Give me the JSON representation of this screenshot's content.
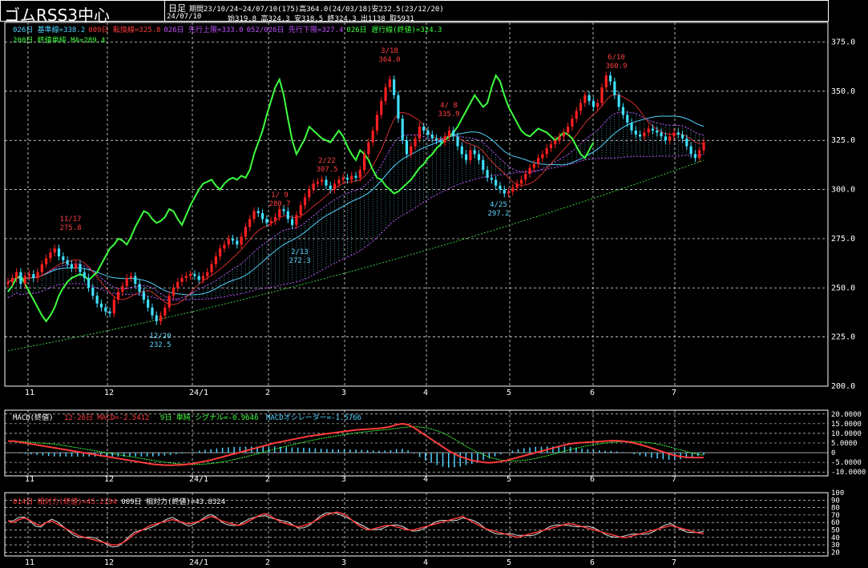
{
  "header": {
    "title": "ゴムRSS3中心",
    "period_type": "日足",
    "period_info": "期間23/10/24~24/07/10(175)高364.0(24/03/18)安232.5(23/12/20)",
    "date": "24/07/10",
    "ohlc": "始319.8 高324.3 安318.5 終324.3 出1138 取5931"
  },
  "legend_main": {
    "line1": [
      {
        "text": "026日 基準線=338.2",
        "color": "#4fd3ff"
      },
      {
        "text": "009日 転換線=325.8",
        "color": "#ff3b3b"
      },
      {
        "text": "026日 先行上限=333.0",
        "color": "#c050ff"
      },
      {
        "text": "052/026日 先行下限=327.4",
        "color": "#c050ff"
      },
      {
        "text": "026日 遅行線(終値)=324.3",
        "color": "#3fff3f"
      }
    ],
    "line2": {
      "text": "200日 終値単純 MA=289.4",
      "color": "#3fff3f"
    }
  },
  "legend_macd": {
    "label": "MACD(終値)",
    "macd": "12-26日 MACD=-2.5412",
    "signal": "9日 単純 シグナル=-0.9646",
    "osc": "MACDオシレーター=-1.5766"
  },
  "legend_rsi": {
    "rsi14": "014日 相対力(終値)=45.2194",
    "rsi9": "009日 相対力(終値)=43.8324"
  },
  "colors": {
    "up": "#ff2020",
    "down": "#40e0ff",
    "kijun": "#4fd3ff",
    "tenkan": "#ff3b3b",
    "chikou": "#3fff3f",
    "ma": "#3fcf3f",
    "cloud": "#c050ff",
    "grid": "#ffffff"
  },
  "chart_data": [
    {
      "type": "candlestick",
      "name": "price",
      "x_labels": [
        "11",
        "12",
        "24/1",
        "2",
        "3",
        "4",
        "5",
        "6",
        "7"
      ],
      "y_ticks": [
        200.0,
        225.0,
        250.0,
        275.0,
        300.0,
        325.0,
        350.0,
        375.0
      ],
      "ylim": [
        200,
        385
      ],
      "grid": true,
      "close": [
        253,
        255,
        258,
        252,
        256,
        257,
        255,
        258,
        262,
        265,
        268,
        270,
        266,
        264,
        262,
        260,
        262,
        258,
        255,
        250,
        246,
        242,
        240,
        238,
        237,
        244,
        248,
        251,
        255,
        256,
        252,
        248,
        244,
        240,
        236,
        233,
        236,
        240,
        246,
        250,
        253,
        255,
        256,
        257,
        256,
        254,
        256,
        258,
        262,
        266,
        270,
        272,
        275,
        274,
        272,
        276,
        281,
        285,
        289,
        288,
        285,
        283,
        284,
        286,
        290,
        289,
        285,
        282,
        287,
        292,
        296,
        300,
        303,
        304,
        305,
        302,
        300,
        303,
        305,
        306,
        305,
        307,
        306,
        310,
        318,
        324,
        330,
        338,
        345,
        352,
        356,
        348,
        336,
        325,
        318,
        322,
        326,
        332,
        330,
        328,
        326,
        325,
        324,
        327,
        330,
        327,
        322,
        318,
        315,
        320,
        318,
        315,
        310,
        306,
        305,
        302,
        300,
        298,
        299,
        301,
        303,
        305,
        308,
        311,
        313,
        316,
        318,
        321,
        323,
        325,
        327,
        329,
        332,
        336,
        340,
        344,
        348,
        345,
        342,
        344,
        352,
        358,
        355,
        348,
        342,
        338,
        334,
        330,
        328,
        327,
        329,
        331,
        330,
        329,
        327,
        325,
        327,
        329,
        328,
        326,
        322,
        318,
        316,
        320,
        324
      ],
      "annotations": [
        {
          "date": "11/17",
          "value": "275.8"
        },
        {
          "date": "12/20",
          "value": "232.5"
        },
        {
          "date": "1/ 9",
          "value": "280.7"
        },
        {
          "date": "2/13",
          "value": "272.3"
        },
        {
          "date": "2/22",
          "value": "307.5"
        },
        {
          "date": "3/18",
          "value": "364.0"
        },
        {
          "date": "4/ 8",
          "value": "335.9"
        },
        {
          "date": "4/25",
          "value": "297.2"
        },
        {
          "date": "6/10",
          "value": "360.9"
        }
      ]
    },
    {
      "type": "line",
      "name": "macd",
      "y_ticks": [
        "20.0000",
        "15.0000",
        "10.0000",
        "5.0000",
        "0",
        "-5.0000",
        "-10.0000"
      ],
      "ylim": [
        -12,
        22
      ],
      "macd": [
        6,
        6,
        5.5,
        5,
        4.5,
        4,
        3.5,
        3,
        2.5,
        2,
        1.5,
        1,
        0.5,
        0,
        -0.5,
        -1,
        -1.5,
        -2,
        -2.5,
        -3,
        -3.5,
        -4,
        -4.5,
        -5,
        -5.5,
        -6,
        -6.2,
        -6.4,
        -6.5,
        -6.4,
        -6.3,
        -6,
        -5.6,
        -5,
        -4.4,
        -3.8,
        -3,
        -2.2,
        -1.4,
        -0.6,
        0.2,
        1,
        1.8,
        2.6,
        3.4,
        4.2,
        5,
        5.6,
        6.2,
        6.8,
        7.4,
        8,
        8.6,
        9,
        9.4,
        9.8,
        10.2,
        10.6,
        11,
        11.4,
        11.8,
        12,
        12.2,
        12.4,
        12.6,
        13,
        13.5,
        14.5,
        15,
        14.5,
        13,
        11,
        9,
        7,
        5,
        3,
        1,
        -0.5,
        -2,
        -3,
        -4,
        -4.5,
        -5,
        -5.2,
        -5,
        -4.6,
        -4,
        -3.2,
        -2.4,
        -1.6,
        -0.8,
        0,
        0.8,
        1.6,
        2.4,
        3.2,
        4,
        4.6,
        5,
        5.2,
        5.4,
        5.6,
        5.8,
        6,
        6.2,
        6.2,
        6,
        5.6,
        5,
        4.2,
        3.4,
        2.4,
        1.4,
        0.4,
        -0.6,
        -1.4,
        -2,
        -2.4,
        -2.6,
        -2.6,
        -2.5
      ],
      "signal_color": "#3fff3f",
      "macd_color": "#ff3b3b"
    },
    {
      "type": "line",
      "name": "rsi",
      "y_ticks": [
        "100",
        "90",
        "80",
        "70",
        "60",
        "50",
        "40",
        "30",
        "20"
      ],
      "ylim": [
        15,
        100
      ],
      "rsi14": [
        62,
        60,
        64,
        66,
        63,
        58,
        56,
        60,
        62,
        58,
        54,
        50,
        46,
        42,
        40,
        38,
        36,
        34,
        32,
        30,
        30,
        33,
        38,
        44,
        48,
        52,
        56,
        58,
        60,
        62,
        64,
        62,
        60,
        58,
        60,
        62,
        65,
        68,
        66,
        62,
        60,
        58,
        56,
        58,
        62,
        66,
        70,
        72,
        68,
        64,
        60,
        58,
        56,
        54,
        56,
        58,
        62,
        66,
        70,
        72,
        74,
        72,
        68,
        62,
        56,
        52,
        50,
        52,
        54,
        56,
        56,
        54,
        52,
        50,
        50,
        52,
        54,
        56,
        58,
        60,
        62,
        64,
        66,
        68,
        64,
        60,
        56,
        52,
        50,
        48,
        46,
        44,
        42,
        40,
        42,
        44,
        46,
        48,
        50,
        52,
        54,
        56,
        58,
        58,
        56,
        54,
        52,
        50,
        48,
        46,
        44,
        42,
        40,
        40,
        42,
        44,
        46,
        48,
        50,
        52,
        54,
        56,
        54,
        52,
        50,
        48,
        46,
        45
      ],
      "rsi14_color": "#ff3b3b",
      "rsi9_color": "#e0e0e0"
    }
  ]
}
